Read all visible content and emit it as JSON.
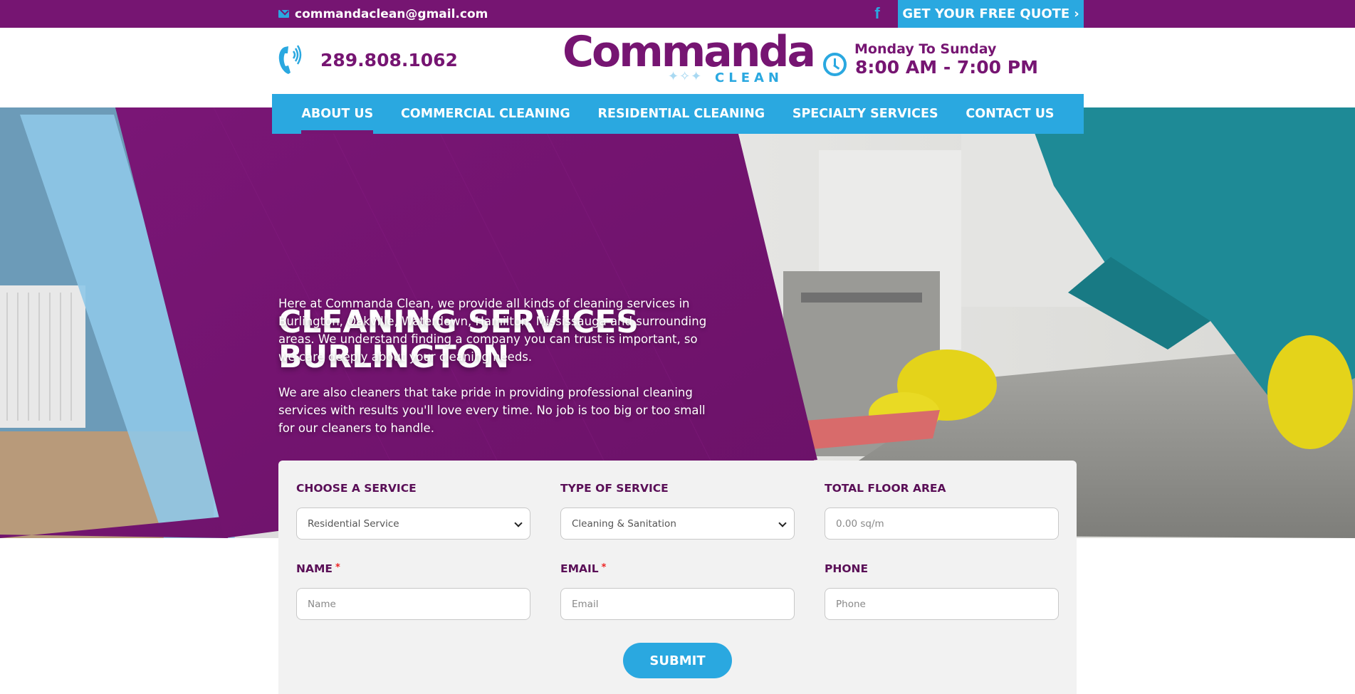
{
  "topbar": {
    "email": "commandaclean@gmail.com",
    "email_icon": "envelope-icon",
    "facebook_icon": "facebook-icon",
    "facebook_glyph": "f",
    "quote_label": "GET YOUR FREE QUOTE",
    "quote_chevron": "›"
  },
  "header": {
    "phone": "289.808.1062",
    "phone_icon": "phone-icon",
    "logo_word": "Commanda",
    "logo_sub": "CLEAN",
    "hours_days": "Monday To Sunday",
    "hours_time": "8:00 AM - 7:00 PM",
    "clock_icon": "clock-icon"
  },
  "nav": {
    "items": [
      {
        "label": "ABOUT US",
        "active": true
      },
      {
        "label": "COMMERCIAL CLEANING"
      },
      {
        "label": "RESIDENTIAL CLEANING"
      },
      {
        "label": "SPECIALTY SERVICES"
      },
      {
        "label": "CONTACT US"
      }
    ]
  },
  "hero": {
    "title_line1": "CLEANING SERVICES",
    "title_line2": "BURLINGTON",
    "paragraph1": "Here at Commanda Clean, we provide all kinds of cleaning services in Burlington, Oakville, Waterdown, Hamilton, Mississauga and surrounding areas. We understand finding a company you can trust is important, so we care deeply about your cleaning needs.",
    "paragraph2": "We are also cleaners that take pride in providing professional cleaning services with results you'll love every time. No job is too big or too small for our cleaners to handle."
  },
  "form": {
    "choose_service_label": "CHOOSE A SERVICE",
    "choose_service_value": "Residential Service",
    "type_service_label": "TYPE OF SERVICE",
    "type_service_value": "Cleaning & Sanitation",
    "floor_area_label": "TOTAL FLOOR AREA",
    "floor_area_placeholder": "0.00 sq/m",
    "name_label": "NAME",
    "name_placeholder": "Name",
    "email_label": "EMAIL",
    "email_placeholder": "Email",
    "phone_label": "PHONE",
    "phone_placeholder": "Phone",
    "required_mark": "*",
    "submit_label": "SUBMIT"
  },
  "colors": {
    "brand_purple": "#761572",
    "brand_blue": "#2aa8e0",
    "form_bg": "#f2f2f2"
  }
}
